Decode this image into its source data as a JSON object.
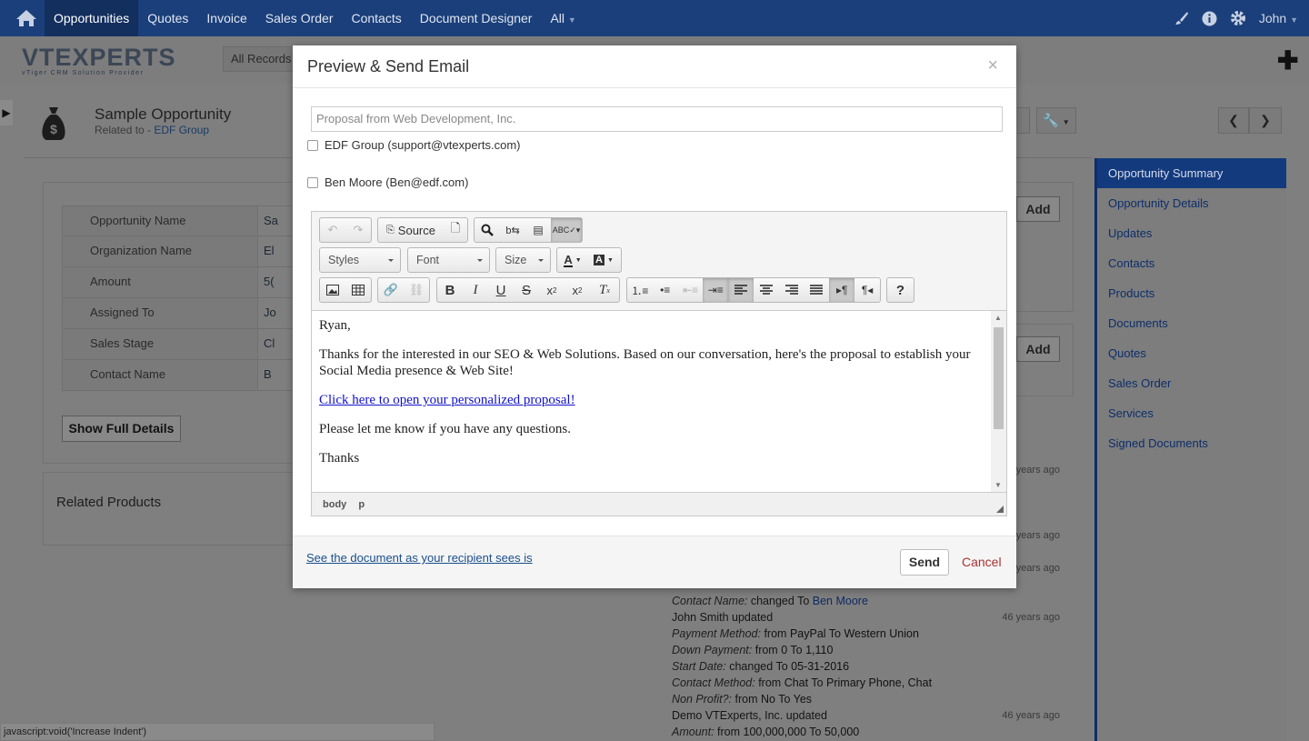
{
  "topnav": {
    "items": [
      "Opportunities",
      "Quotes",
      "Invoice",
      "Sales Order",
      "Contacts",
      "Document Designer",
      "All"
    ],
    "user": "John"
  },
  "header": {
    "logo_text": "VTEXPERTS",
    "logo_tagline": "vTiger CRM Solution Provider",
    "filter": "All Records"
  },
  "record": {
    "title": "Sample Opportunity",
    "related_prefix": "Related to - ",
    "related_link": "EDF Group"
  },
  "details": {
    "rows": [
      {
        "label": "Opportunity Name",
        "value": "Sa"
      },
      {
        "label": "Organization Name",
        "value": "El"
      },
      {
        "label": "Amount",
        "value": "5("
      },
      {
        "label": "Assigned To",
        "value": "Jo"
      },
      {
        "label": "Sales Stage",
        "value": "Cl"
      },
      {
        "label": "Contact Name",
        "value": "B"
      }
    ],
    "show_full": "Show Full Details",
    "related_products": "Related Products",
    "add": "Add"
  },
  "right_nav": {
    "items": [
      "Opportunity Summary",
      "Opportunity Details",
      "Updates",
      "Contacts",
      "Products",
      "Documents",
      "Quotes",
      "Sales Order",
      "Services",
      "Signed Documents"
    ]
  },
  "feed": {
    "ago": "46 years ago",
    "ago_partial": "years ago",
    "contact_name_label": "Contact Name",
    "contact_changed": "changed To",
    "contact_value": "Ben Moore",
    "user_update": "John Smith",
    "updated": "updated",
    "pay_label": "Payment Method",
    "pay_from": "PayPal",
    "pay_to": "Western Union",
    "down_label": "Down Payment",
    "down_from": "0",
    "down_to": "1,110",
    "start_label": "Start Date",
    "start_to": "05-31-2016",
    "cm_label": "Contact Method",
    "cm_from": "Chat",
    "cm_to": "Primary Phone, Chat",
    "np_label": "Non Profit?",
    "np_from": "No",
    "np_to": "Yes",
    "org_update": "Demo VTExperts, Inc.",
    "amt_label": "Amount",
    "amt_from": "100,000,000",
    "amt_to": "50,000",
    "from": "from",
    "to": "To",
    "changed_to": "changed To"
  },
  "status_bar": "javascript:void('Increase Indent')",
  "modal": {
    "title": "Preview & Send Email",
    "close": "×",
    "subject": "Proposal from Web Development, Inc.",
    "recipients": [
      "EDF Group (support@vtexperts.com)",
      "Ben Moore (Ben@edf.com)"
    ],
    "toolbar": {
      "source": "Source",
      "styles": "Styles",
      "font": "Font",
      "size": "Size"
    },
    "body": {
      "greeting": "Ryan,",
      "para1": "Thanks for the interested in our SEO & Web Solutions. Based on our conversation, here's the proposal to establish your Social Media presence & Web Site!",
      "link": "Click here to open your personalized proposal!",
      "para2": "Please let me know if you have any questions.",
      "closing": "Thanks"
    },
    "path": [
      "body",
      "p"
    ],
    "see_doc": "See the document as your recipient sees is",
    "send": "Send",
    "cancel": "Cancel"
  }
}
